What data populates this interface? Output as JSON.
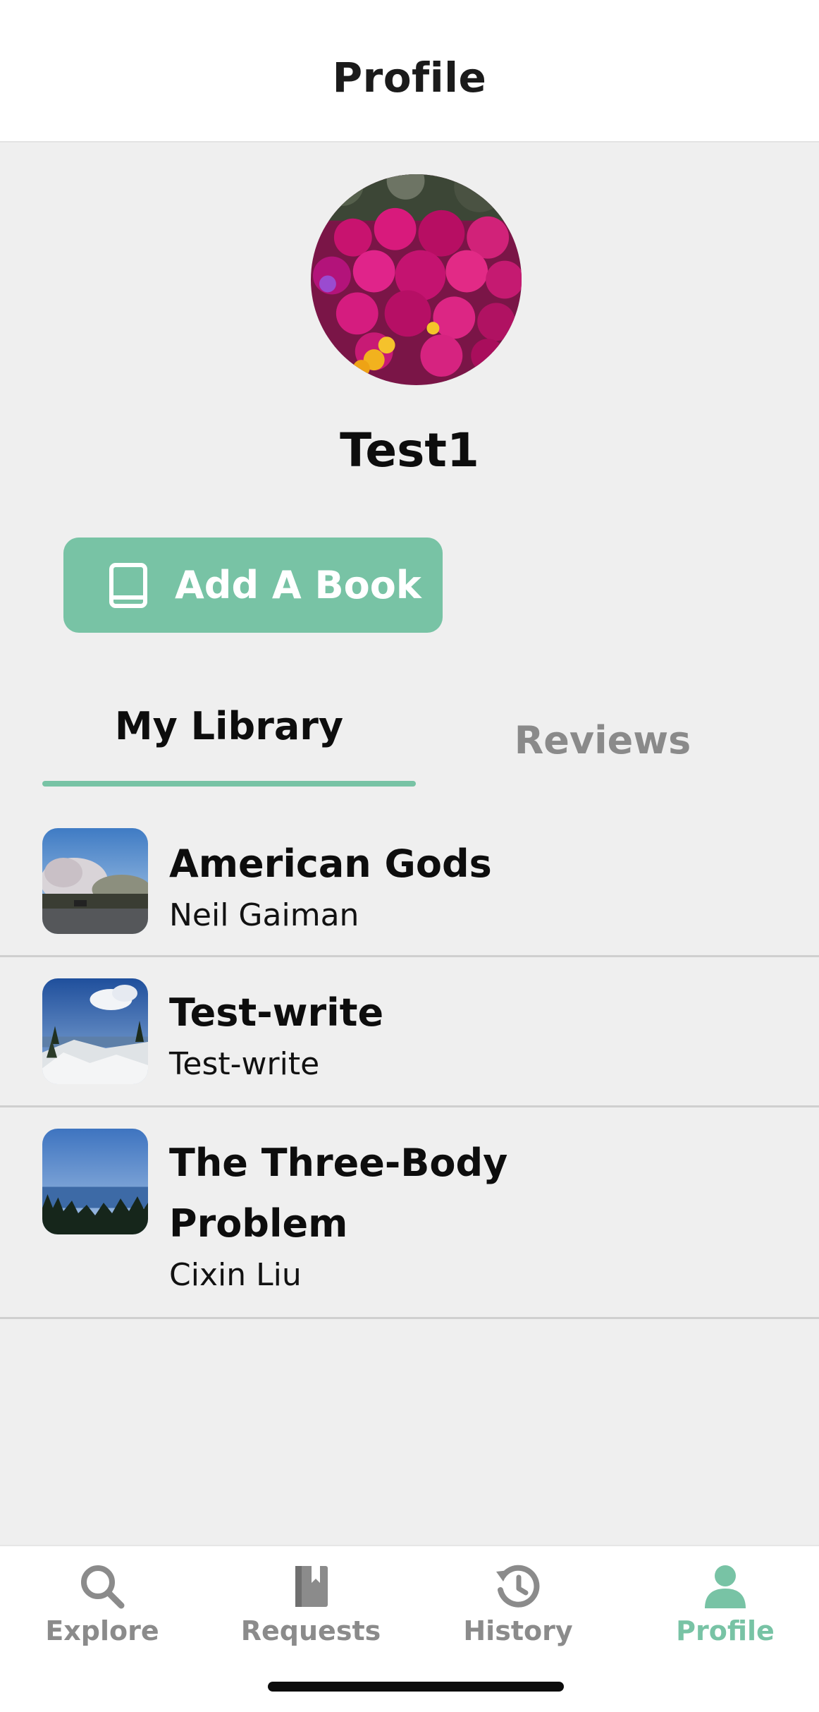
{
  "header": {
    "title": "Profile"
  },
  "profile": {
    "username": "Test1",
    "avatar_icon": "flower-photo"
  },
  "actions": {
    "add_book_label": "Add A Book",
    "add_book_icon": "book-icon"
  },
  "tabs": [
    {
      "label": "My Library",
      "active": true
    },
    {
      "label": "Reviews",
      "active": false
    }
  ],
  "library": [
    {
      "title": "American Gods",
      "author": "Neil Gaiman",
      "thumb": "tree-road-photo"
    },
    {
      "title": "Test-write",
      "author": "Test-write",
      "thumb": "snowy-mountain-photo"
    },
    {
      "title": "The Three-Body Problem",
      "author": "Cixin Liu",
      "thumb": "ocean-forest-photo"
    }
  ],
  "nav": [
    {
      "label": "Explore",
      "icon": "search-icon",
      "active": false
    },
    {
      "label": "Requests",
      "icon": "book-icon",
      "active": false
    },
    {
      "label": "History",
      "icon": "history-icon",
      "active": false
    },
    {
      "label": "Profile",
      "icon": "person-icon",
      "active": true
    }
  ],
  "colors": {
    "accent": "#78c3a5",
    "inactive": "#8b8b8b",
    "background": "#efefef"
  }
}
